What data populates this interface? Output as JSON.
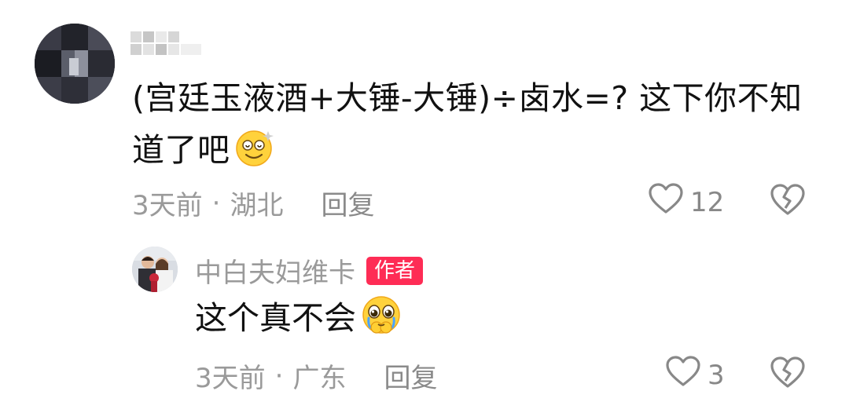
{
  "comment": {
    "text": "(宫廷玉液酒+大锤-大锤)÷卤水=?    这下你不知道了吧",
    "emoji_icon": "dizzy-smile-emoji",
    "meta": {
      "time": "3天前",
      "separator": "·",
      "location": "湖北",
      "reply_label": "回复"
    },
    "likes": "12",
    "like_icon": "heart-outline-icon",
    "dislike_icon": "broken-heart-icon"
  },
  "reply": {
    "username": "中白夫妇维卡",
    "badge": "作者",
    "text": "这个真不会",
    "emoji_icon": "pleading-face-emoji",
    "meta": {
      "time": "3天前",
      "separator": "·",
      "location": "广东",
      "reply_label": "回复"
    },
    "likes": "3",
    "like_icon": "heart-outline-icon",
    "dislike_icon": "broken-heart-icon"
  },
  "colors": {
    "text_primary": "#111111",
    "text_secondary": "#9a9a9a",
    "author_badge": "#fe2c55",
    "icon_gray": "#888888"
  }
}
